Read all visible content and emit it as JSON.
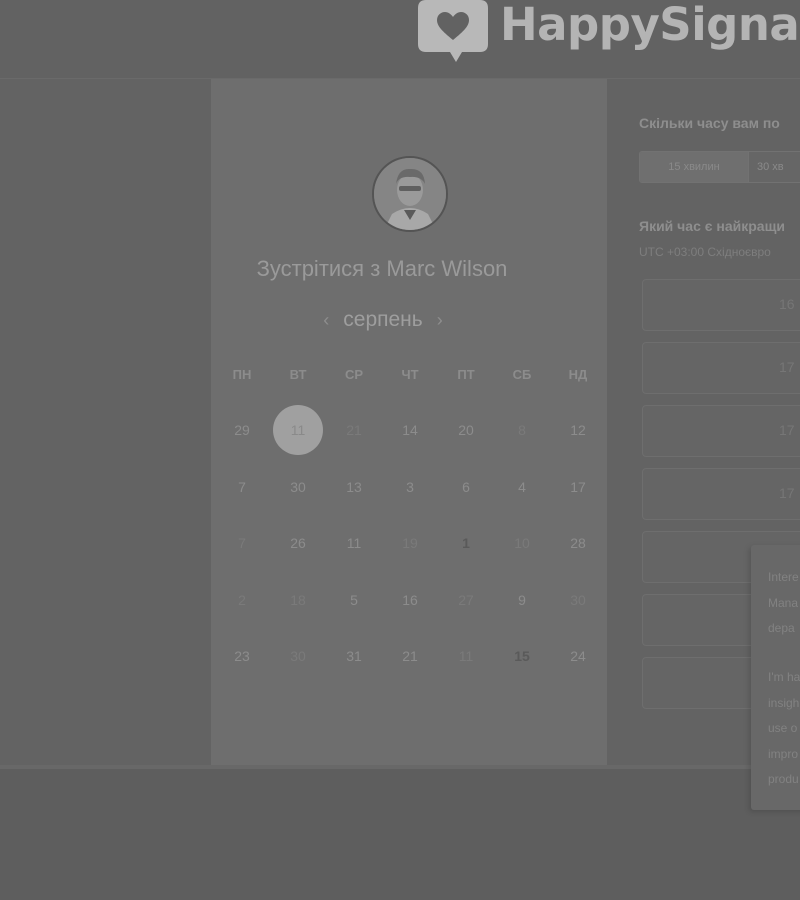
{
  "header": {
    "brand": "HappySignals"
  },
  "booking": {
    "title": "Зустрітися з Marc Wilson",
    "month": "серпень",
    "prev_icon": "chevron-left-icon",
    "next_icon": "chevron-right-icon"
  },
  "calendar": {
    "weekdays": [
      "ПН",
      "ВТ",
      "СР",
      "ЧТ",
      "ПТ",
      "СБ",
      "НД"
    ],
    "rows": [
      [
        "29",
        "11",
        "21",
        "14",
        "20",
        "8",
        "12"
      ],
      [
        "7",
        "30",
        "13",
        "3",
        "6",
        "4",
        "17"
      ],
      [
        "7",
        "26",
        "11",
        "19",
        "1",
        "10",
        "28"
      ],
      [
        "2",
        "18",
        "5",
        "16",
        "27",
        "9",
        "30"
      ],
      [
        "23",
        "30",
        "31",
        "21",
        "11",
        "15",
        "24"
      ]
    ],
    "selected": "11"
  },
  "duration": {
    "question": "Скільки часу вам по",
    "options": [
      "15 хвилин",
      "30 хв"
    ]
  },
  "time": {
    "question": "Який час є найкращи",
    "timezone": "UTC +03:00 Східноєвро",
    "slots": [
      "16",
      "17",
      "17",
      "17",
      "",
      "",
      "",
      ""
    ]
  },
  "popover": {
    "lines": [
      "Intere",
      "Mana",
      "depa",
      "",
      "I'm ha",
      "insigh",
      "use o",
      "impro",
      "produ"
    ]
  }
}
